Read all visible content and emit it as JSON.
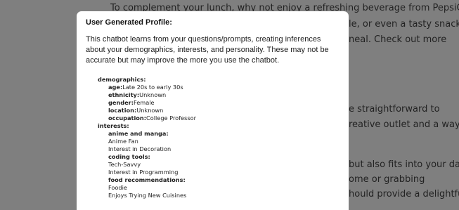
{
  "background_lines": [
    {
      "text": "To complement your lunch, why not enjoy a refreshing beverage from PepsiCo?"
    },
    {
      "text": "le, or even a tasty snack,"
    },
    {
      "text": "neal. Check out more"
    },
    {
      "text": "e straightforward to"
    },
    {
      "text": "reative outlet and a way to"
    },
    {
      "text": "but also fits into your day"
    },
    {
      "text": "ome or grabbing"
    },
    {
      "text": "hould provide a delightful"
    }
  ],
  "modal": {
    "title": "User Generated Profile:",
    "description": "This chatbot learns from your questions/prompts, creating inferences about your demographics, interests, and personality. These may not be accurate but may improve the more you use the chatbot."
  },
  "profile": {
    "demographics": {
      "label": "demographics:",
      "age": {
        "key": "age:",
        "value": "Late 20s to early 30s"
      },
      "ethnicity": {
        "key": "ethnicity:",
        "value": "Unknown"
      },
      "gender": {
        "key": "gender:",
        "value": "Female"
      },
      "location": {
        "key": "location:",
        "value": "Unknown"
      },
      "occupation": {
        "key": "occupation:",
        "value": "College Professor"
      }
    },
    "interests": {
      "label": "interests:",
      "anime": {
        "key": "anime and manga:",
        "items": [
          "Anime Fan",
          "Interest in Decoration"
        ]
      },
      "coding": {
        "key": "coding tools:",
        "items": [
          "Tech-Savvy",
          "Interest in Programming"
        ]
      },
      "food": {
        "key": "food recommendations:",
        "items": [
          "Foodie",
          "Enjoys Trying New Cuisines"
        ]
      }
    }
  }
}
